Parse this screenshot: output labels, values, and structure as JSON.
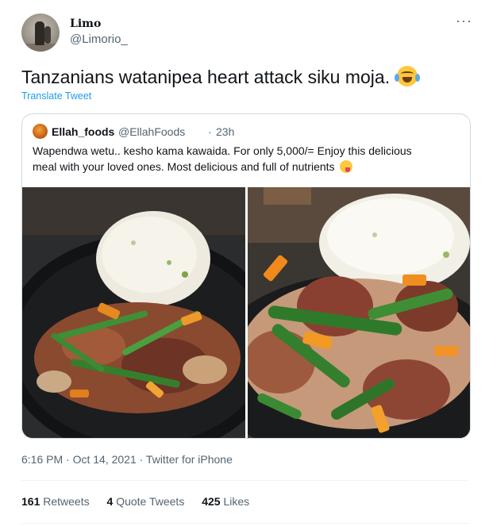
{
  "author": {
    "display_name": "Limo",
    "handle": "@Limorio_",
    "avatar_icon": "person-photo-avatar",
    "more_icon": "more-options-icon"
  },
  "tweet": {
    "text": "Tanzanians watanipea heart attack siku moja.",
    "emoji": "face-with-tears-of-joy-emoji",
    "translate_label": "Translate Tweet"
  },
  "quoted_tweet": {
    "display_name": "Ellah_foods",
    "handle": "@EllahFoods",
    "separator": "·",
    "time": "23h",
    "text_line1": "Wapendwa wetu.. kesho kama kawaida. For  only 5,000/= Enjoy this delicious",
    "text_line2": "meal with your loved ones. Most delicious and full of nutrients",
    "emoji": "face-savoring-food-emoji",
    "photos": [
      "rice-and-beef-stir-fry-photo-1",
      "rice-and-beef-stir-fry-photo-2"
    ]
  },
  "meta": {
    "line": "6:16 PM · Oct 14, 2021 · Twitter for iPhone"
  },
  "stats": {
    "retweets_count": "161",
    "retweets_label": "Retweets",
    "quotes_count": "4",
    "quotes_label": "Quote Tweets",
    "likes_count": "425",
    "likes_label": "Likes"
  },
  "colors": {
    "link": "#1d9bf0",
    "secondary_text": "#536471",
    "primary_text": "#0f1419",
    "border": "#cfd9de"
  }
}
